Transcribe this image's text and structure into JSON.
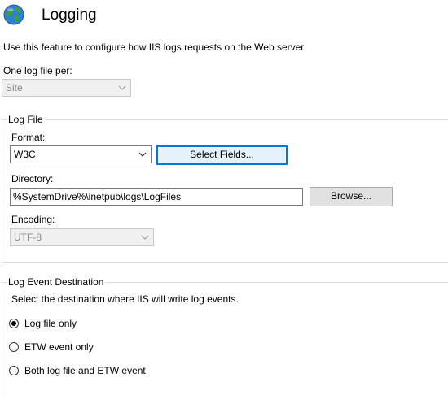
{
  "header": {
    "title": "Logging",
    "icon": "globe-icon"
  },
  "description": "Use this feature to configure how IIS logs requests on the Web server.",
  "log_per": {
    "label": "One log file per:",
    "value": "Site"
  },
  "log_file": {
    "group_label": "Log File",
    "format_label": "Format:",
    "format_value": "W3C",
    "select_fields_label": "Select Fields...",
    "directory_label": "Directory:",
    "directory_value": "%SystemDrive%\\inetpub\\logs\\LogFiles",
    "browse_label": "Browse...",
    "encoding_label": "Encoding:",
    "encoding_value": "UTF-8"
  },
  "destination": {
    "group_label": "Log Event Destination",
    "description": "Select the destination where IIS will write log events.",
    "options": [
      {
        "label": "Log file only",
        "selected": true
      },
      {
        "label": "ETW event only",
        "selected": false
      },
      {
        "label": "Both log file and ETW event",
        "selected": false
      }
    ]
  },
  "colors": {
    "accent": "#0078d7",
    "disabled_bg": "#f0f0f0",
    "border": "#7a7a7a"
  }
}
